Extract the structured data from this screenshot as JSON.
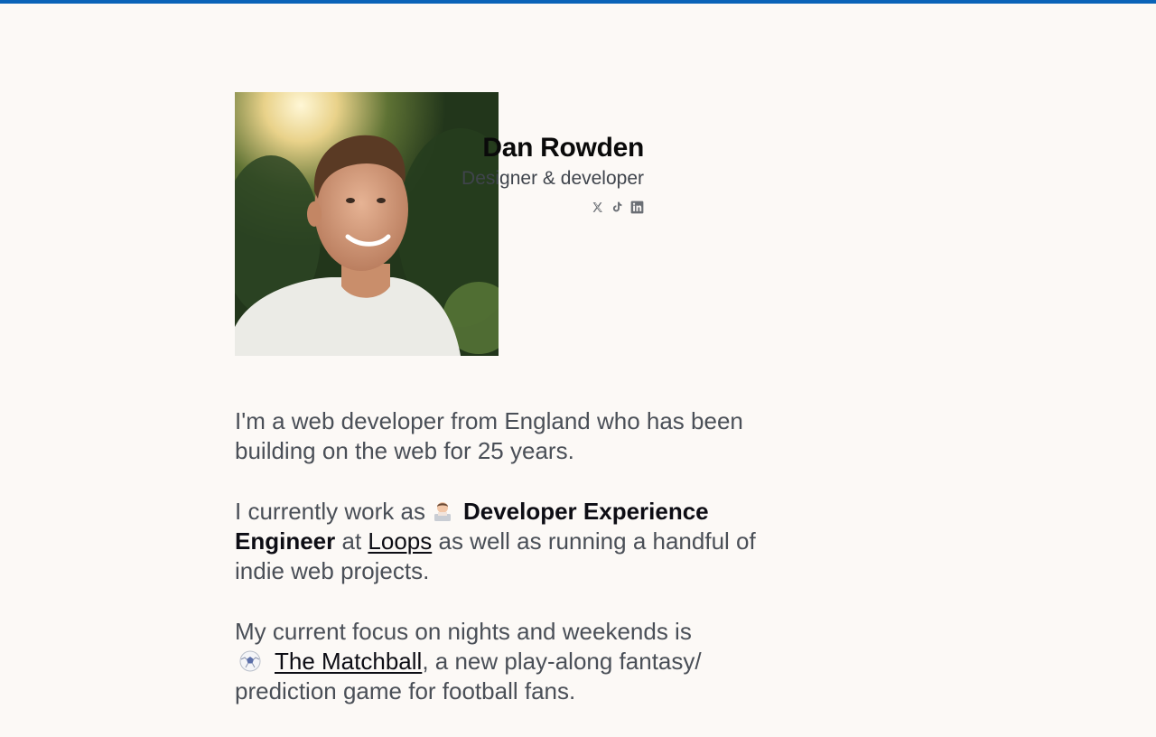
{
  "profile": {
    "name": "Dan Rowden",
    "tagline": "Designer & developer",
    "photo_alt": "Dan Rowden"
  },
  "socials": [
    {
      "name": "x-icon",
      "label": "X"
    },
    {
      "name": "tiktok-icon",
      "label": "TikTok"
    },
    {
      "name": "linkedin-icon",
      "label": "LinkedIn"
    }
  ],
  "bio": {
    "p1": "I'm a web developer from England who has been building on the web for 25 years.",
    "p2_pre": "I currently work as",
    "p2_role": "Developer Experience Engineer",
    "p2_at": "at",
    "p2_link": "Loops",
    "p2_post": "as well as running a handful of indie web projects.",
    "p3_pre": "My current focus on nights and weekends is",
    "p3_link": "The Matchball",
    "p3_post": ", a new play-along fantasy/ prediction game for football fans."
  },
  "colors": {
    "accent": "#0a63b8",
    "background": "#fcf9f6",
    "text": "#4a4f57",
    "heading": "#0a0a0a"
  }
}
